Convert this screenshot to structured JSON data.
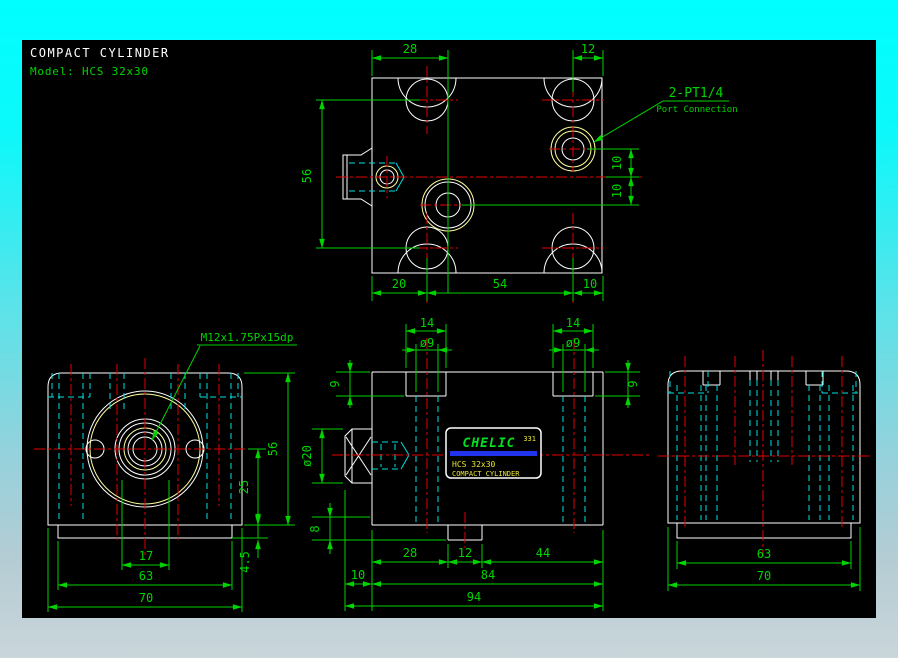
{
  "header": {
    "title": "COMPACT CYLINDER",
    "model": "Model: HCS 32x30"
  },
  "callouts": {
    "port": {
      "title": "2-PT1/4",
      "subtitle": "Port Connection"
    },
    "thread": "M12x1.75Px15dp"
  },
  "nameplate": {
    "brand": "CHELIC",
    "code": "331",
    "model": "HCS 32x30",
    "product": "COMPACT CYLINDER"
  },
  "views": {
    "top": {
      "dims": {
        "w28": "28",
        "w12": "12",
        "h56": "56",
        "b20": "20",
        "b54": "54",
        "b10": "10",
        "r10a": "10",
        "r10b": "10"
      }
    },
    "front": {
      "dims": {
        "b17": "17",
        "b63": "63",
        "b70": "70",
        "r56": "56",
        "r25": "25",
        "r45": "4.5"
      }
    },
    "side": {
      "dims": {
        "t14l": "14",
        "d9l": "ø9",
        "t14r": "14",
        "d9r": "ø9",
        "dep9l": "9",
        "dep9r": "9",
        "rod20": "ø20",
        "p8": "8",
        "b28": "28",
        "b12": "12",
        "b44": "44",
        "b10": "10",
        "b84": "84",
        "b94": "94"
      }
    },
    "rear": {
      "dims": {
        "b63": "63",
        "b70": "70"
      }
    }
  },
  "colors": {
    "background_top": "#00ffff",
    "background_bottom": "#c9d6da",
    "canvas": "#000000",
    "outline": "#ffffff",
    "dimension_green": "#00d400",
    "centerline_red": "#e60000",
    "hidden_cyan": "#00e0e0",
    "feature_yellow": "#ffff9c",
    "nameplate_blue": "#2233ee",
    "nameplate_text": "#e6e632"
  }
}
